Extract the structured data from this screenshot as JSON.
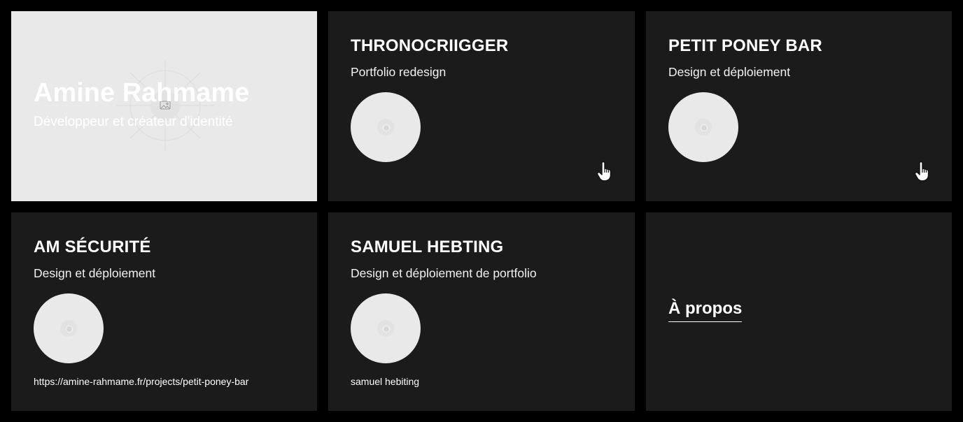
{
  "hero": {
    "name": "Amine Rahmame",
    "role": "Développeur et créateur d'identité",
    "image_icon": "image-icon",
    "background": "#e9e9e9"
  },
  "projects": [
    {
      "title": "THRONOCRIIGGER",
      "subtitle": "Portfolio redesign",
      "caption": "",
      "cursor_icon": "hand-pointer-icon"
    },
    {
      "title": "PETIT PONEY BAR",
      "subtitle": "Design et déploiement",
      "caption": "",
      "cursor_icon": "hand-pointer-icon"
    },
    {
      "title": "AM SÉCURITÉ",
      "subtitle": "Design et déploiement",
      "caption": "https://amine-rahmame.fr/projects/petit-poney-bar"
    },
    {
      "title": "SAMUEL HEBTING",
      "subtitle": "Design et déploiement de portfolio",
      "caption": "samuel hebiting"
    }
  ],
  "about": {
    "label": "À propos"
  },
  "colors": {
    "page_bg": "#000000",
    "card_bg": "#1b1b1b",
    "thumb_bg": "#e9e9e9",
    "text": "#ffffff"
  }
}
